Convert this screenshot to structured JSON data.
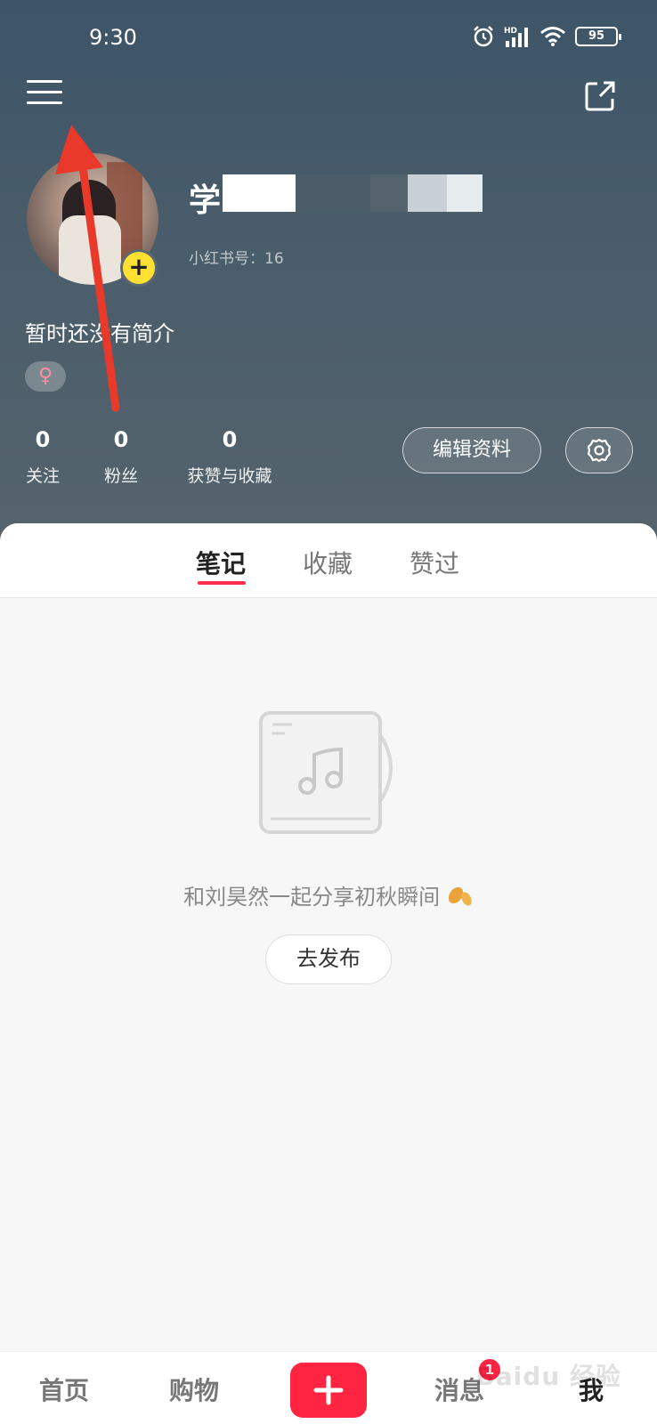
{
  "status_bar": {
    "time": "9:30",
    "battery": "95",
    "icons": [
      "alarm-icon",
      "hd-signal-icon",
      "wifi-icon",
      "battery-icon"
    ]
  },
  "top_bar": {
    "menu_icon": "hamburger-menu-icon",
    "share_icon": "share-external-icon"
  },
  "profile": {
    "name_visible": "学",
    "redbook_id": "小红书号：16",
    "bio": "暂时还没有简介",
    "gender_symbol": "♀",
    "avatar_add": "+"
  },
  "stats": [
    {
      "value": "0",
      "label": "关注"
    },
    {
      "value": "0",
      "label": "粉丝"
    },
    {
      "value": "0",
      "label": "获赞与收藏"
    }
  ],
  "actions": {
    "edit_profile": "编辑资料",
    "settings_icon": "gear-icon"
  },
  "tabs": [
    {
      "label": "笔记",
      "active": true
    },
    {
      "label": "收藏",
      "active": false
    },
    {
      "label": "赞过",
      "active": false
    }
  ],
  "empty_state": {
    "message": "和刘昊然一起分享初秋瞬间",
    "button": "去发布",
    "illustration": "music-album-icon"
  },
  "bottom_nav": {
    "home": "首页",
    "shop": "购物",
    "create": "+",
    "messages": "消息",
    "messages_badge": "1",
    "me": "我"
  },
  "watermark": "Baidu 经验",
  "colors": {
    "accent": "#ff2442",
    "header": "#445866",
    "badge_yellow": "#ffe033"
  }
}
